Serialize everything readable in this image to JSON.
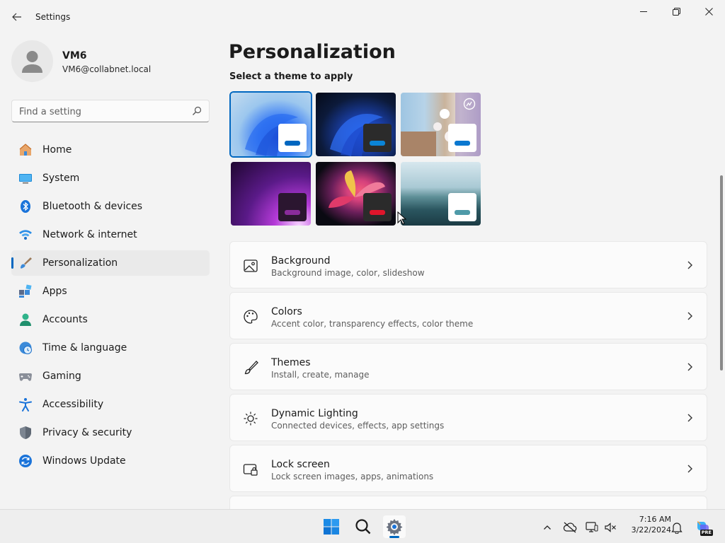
{
  "window": {
    "title": "Settings",
    "controls": {
      "minimize": "minimize",
      "maximize": "maximize",
      "close": "close"
    }
  },
  "profile": {
    "name": "VM6",
    "email": "VM6@collabnet.local"
  },
  "search": {
    "placeholder": "Find a setting",
    "value": ""
  },
  "sidebar": {
    "items": [
      {
        "label": "Home",
        "icon": "home-icon"
      },
      {
        "label": "System",
        "icon": "system-icon"
      },
      {
        "label": "Bluetooth & devices",
        "icon": "bluetooth-icon"
      },
      {
        "label": "Network & internet",
        "icon": "wifi-icon"
      },
      {
        "label": "Personalization",
        "icon": "paintbrush-icon",
        "active": true
      },
      {
        "label": "Apps",
        "icon": "apps-icon"
      },
      {
        "label": "Accounts",
        "icon": "accounts-icon"
      },
      {
        "label": "Time & language",
        "icon": "clock-globe-icon"
      },
      {
        "label": "Gaming",
        "icon": "gamepad-icon"
      },
      {
        "label": "Accessibility",
        "icon": "accessibility-icon"
      },
      {
        "label": "Privacy & security",
        "icon": "shield-icon"
      },
      {
        "label": "Windows Update",
        "icon": "update-icon"
      }
    ]
  },
  "main": {
    "title": "Personalization",
    "theme_section_label": "Select a theme to apply",
    "themes": [
      {
        "name": "windows-light",
        "selected": true,
        "accent": "#0067c0"
      },
      {
        "name": "windows-dark",
        "accent": "#0a84d6"
      },
      {
        "name": "spotlight",
        "accent": "#0a78d0"
      },
      {
        "name": "glow",
        "accent": "#8a2c9c"
      },
      {
        "name": "captured-motion",
        "accent": "#e0152b"
      },
      {
        "name": "flow",
        "accent": "#4e9aa8"
      }
    ],
    "cards": [
      {
        "title": "Background",
        "subtitle": "Background image, color, slideshow",
        "icon": "image-icon"
      },
      {
        "title": "Colors",
        "subtitle": "Accent color, transparency effects, color theme",
        "icon": "palette-icon"
      },
      {
        "title": "Themes",
        "subtitle": "Install, create, manage",
        "icon": "brush-icon"
      },
      {
        "title": "Dynamic Lighting",
        "subtitle": "Connected devices, effects, app settings",
        "icon": "sun-icon"
      },
      {
        "title": "Lock screen",
        "subtitle": "Lock screen images, apps, animations",
        "icon": "lock-screen-icon"
      }
    ]
  },
  "taskbar": {
    "clock_time": "7:16 AM",
    "clock_date": "3/22/2024",
    "copilot_badge": "PRE"
  },
  "colors": {
    "accent": "#0067c0",
    "background": "#f3f3f3",
    "card": "#fbfbfb"
  }
}
